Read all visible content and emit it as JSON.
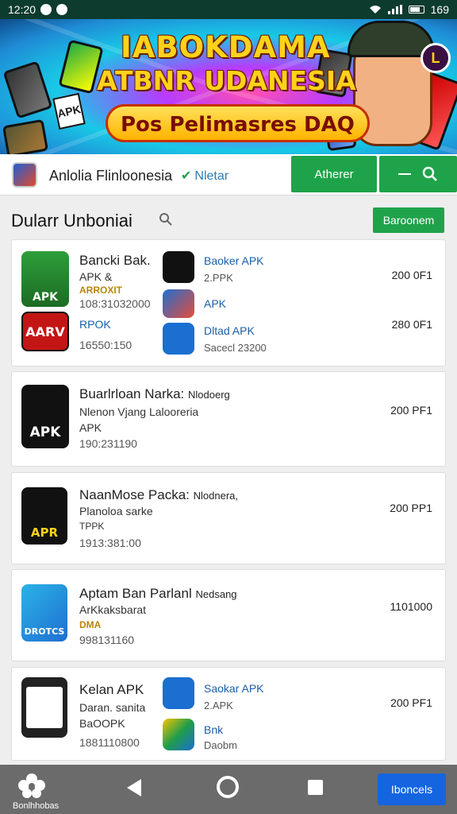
{
  "status_bar": {
    "time": "12:20",
    "right_text": "169"
  },
  "banner": {
    "line1": "IABOKDAMA",
    "line2": "ATBNR UDANESIA",
    "line3": "Pos Pelimasres DAQ",
    "apk_tag": "APK",
    "badge": "L"
  },
  "header": {
    "app_name": "Anlolia Flinloonesia",
    "verify_label": "Nletar",
    "primary_button": "Atherer"
  },
  "section": {
    "title": "Dularr Unboniai",
    "action_button": "Baroonem"
  },
  "cards": [
    {
      "title": "Bancki Bak.",
      "subtitle": "APK &",
      "tag": "ARROXIT",
      "meta": "108:31032000",
      "icon_text": "APK",
      "second_icon_text": "AARV",
      "second_sub": "RPOK",
      "second_meta": "16550:150",
      "side_items": [
        {
          "title": "Baoker APK",
          "sub": "2.PPK"
        },
        {
          "title": "APK",
          "sub": ""
        },
        {
          "title": "Dltad APK",
          "sub": "Sacecl 23200"
        }
      ],
      "sizes": [
        "200 0F1",
        "280 0F1"
      ]
    },
    {
      "title": "Buarlrloan Narka:",
      "title_suffix": "Nlodoerg",
      "subtitle": "Nlenon Vjang Lalooreria",
      "sub2": "APK",
      "meta": "190:231190",
      "icon_text": "APK",
      "size": "200 PF1"
    },
    {
      "title": "NaanMose Packa:",
      "title_suffix": "Nlodnera,",
      "subtitle": "Planoloa sarke",
      "sub2": "TPPK",
      "meta": "1913:381:00",
      "icon_text": "APR",
      "size": "200 PP1"
    },
    {
      "title": "Aptam Ban Parlanl",
      "title_suffix": "Nedsang",
      "subtitle": "ArKkaksbarat",
      "tag": "DMA",
      "meta": "998131160",
      "icon_text": "DROTCS",
      "size": "1101000"
    },
    {
      "title": "Kelan APK",
      "subtitle": "Daran. sanita",
      "sub2": "BaOOPK",
      "meta": "1881110800",
      "side_items": [
        {
          "title": "Saokar APK",
          "sub": "2.APK"
        },
        {
          "title": "Bnk",
          "sub": "Daobm"
        }
      ],
      "size": "200 PF1"
    }
  ],
  "navbar": {
    "home_label": "Bonlhhobas",
    "cta_label": "Iboncels"
  },
  "colors": {
    "accent": "#1fa34a",
    "cta": "#1565e0",
    "status": "#0d3b2e"
  }
}
